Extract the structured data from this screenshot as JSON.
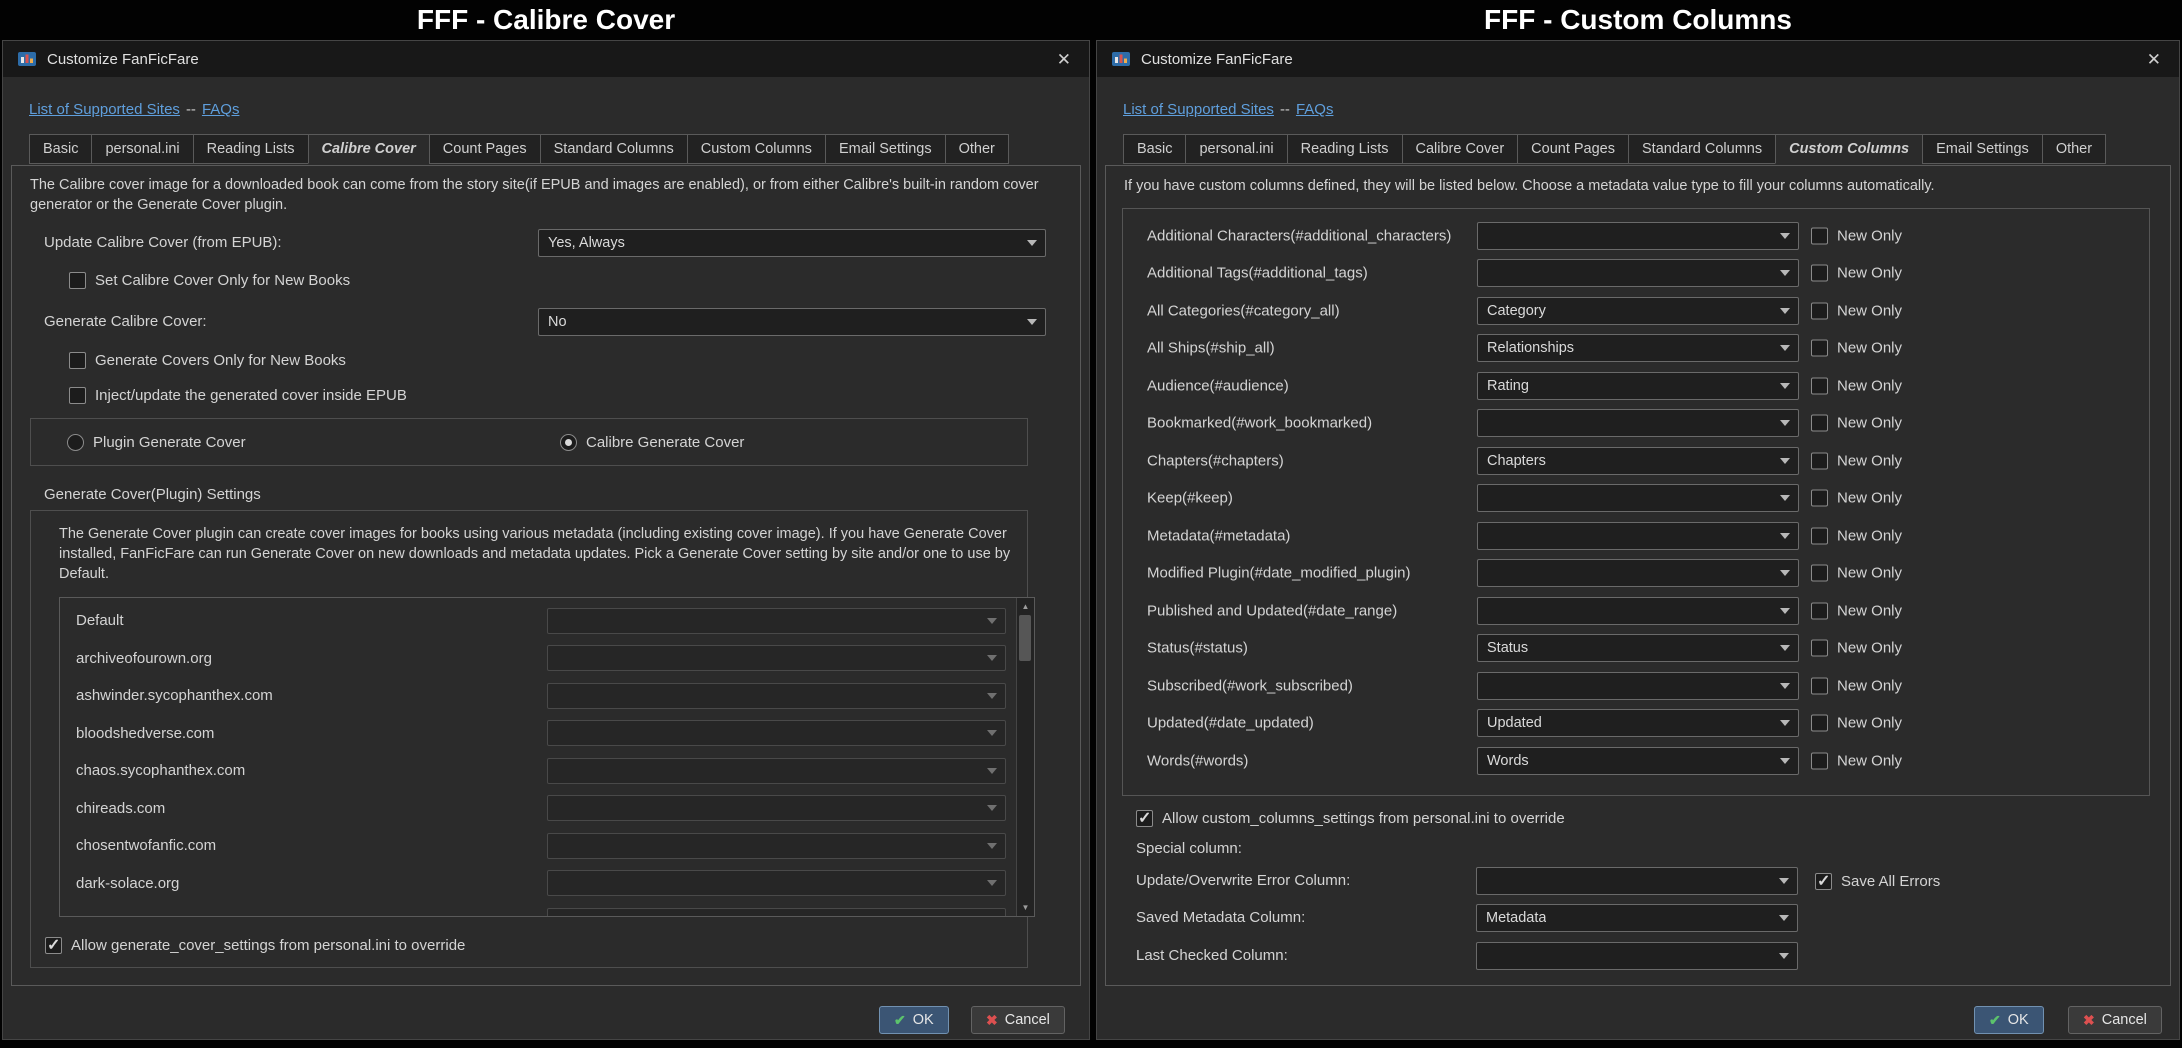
{
  "page": {
    "left_caption": "FFF - Calibre Cover",
    "right_caption": "FFF - Custom Columns"
  },
  "shared": {
    "window_title": "Customize FanFicFare",
    "links": {
      "sites": "List of Supported Sites",
      "separator": "--",
      "faqs": "FAQs"
    },
    "tabs": [
      "Basic",
      "personal.ini",
      "Reading Lists",
      "Calibre Cover",
      "Count Pages",
      "Standard Columns",
      "Custom Columns",
      "Email Settings",
      "Other"
    ],
    "icons": {
      "close": "✕",
      "ok_check": "✔",
      "cancel_x": "✖",
      "scroll_up": "▲",
      "scroll_down": "▼"
    },
    "ok_label": "OK",
    "cancel_label": "Cancel"
  },
  "calibre_cover": {
    "active_tab": "Calibre Cover",
    "intro": "The Calibre cover image for a downloaded book can come from the story site(if EPUB and images are enabled), or from either Calibre's built-in random cover generator or the Generate Cover plugin.",
    "update_cover_label": "Update Calibre Cover (from EPUB):",
    "update_cover_value": "Yes, Always",
    "set_cover_label": "Set Calibre Cover Only for New Books",
    "set_cover_checked": false,
    "generate_cover_label": "Generate Calibre Cover:",
    "generate_cover_value": "No",
    "generate_new_label": "Generate Covers Only for New Books",
    "generate_new_checked": false,
    "inject_label": "Inject/update the generated cover inside EPUB",
    "inject_checked": false,
    "radio_plugin_label": "Plugin Generate Cover",
    "radio_plugin_selected": false,
    "radio_calibre_label": "Calibre Generate Cover",
    "radio_calibre_selected": true,
    "settings_title": "Generate Cover(Plugin) Settings",
    "settings_desc": "The Generate Cover plugin can create cover images for books using various metadata (including existing cover image).  If you have Generate Cover installed, FanFicFare can run Generate Cover on new downloads and metadata updates.  Pick a Generate Cover setting by site and/or one to use by Default.",
    "sites": [
      "Default",
      "archiveofourown.org",
      "ashwinder.sycophanthex.com",
      "bloodshedverse.com",
      "chaos.sycophanthex.com",
      "chireads.com",
      "chosentwofanfic.com",
      "dark-solace.org"
    ],
    "override_label": "Allow generate_cover_settings from personal.ini to override",
    "override_checked": true
  },
  "custom_columns": {
    "active_tab": "Custom Columns",
    "intro": "If you have custom columns defined, they will be listed below.  Choose a metadata value type to fill your columns automatically.",
    "new_only_label": "New Only",
    "rows": [
      {
        "label": "Additional Characters(#additional_characters)",
        "value": ""
      },
      {
        "label": "Additional Tags(#additional_tags)",
        "value": ""
      },
      {
        "label": "All Categories(#category_all)",
        "value": "Category"
      },
      {
        "label": "All Ships(#ship_all)",
        "value": "Relationships"
      },
      {
        "label": "Audience(#audience)",
        "value": "Rating"
      },
      {
        "label": "Bookmarked(#work_bookmarked)",
        "value": ""
      },
      {
        "label": "Chapters(#chapters)",
        "value": "Chapters"
      },
      {
        "label": "Keep(#keep)",
        "value": ""
      },
      {
        "label": "Metadata(#metadata)",
        "value": ""
      },
      {
        "label": "Modified Plugin(#date_modified_plugin)",
        "value": ""
      },
      {
        "label": "Published and Updated(#date_range)",
        "value": ""
      },
      {
        "label": "Status(#status)",
        "value": "Status"
      },
      {
        "label": "Subscribed(#work_subscribed)",
        "value": ""
      },
      {
        "label": "Updated(#date_updated)",
        "value": "Updated"
      },
      {
        "label": "Words(#words)",
        "value": "Words"
      }
    ],
    "override_label": "Allow custom_columns_settings from personal.ini to override",
    "override_checked": true,
    "special_heading": "Special column:",
    "error_column_label": "Update/Overwrite Error Column:",
    "error_column_value": "",
    "save_all_errors_label": "Save All Errors",
    "save_all_errors_checked": true,
    "saved_metadata_label": "Saved Metadata Column:",
    "saved_metadata_value": "Metadata",
    "last_checked_label": "Last Checked Column:",
    "last_checked_value": ""
  }
}
